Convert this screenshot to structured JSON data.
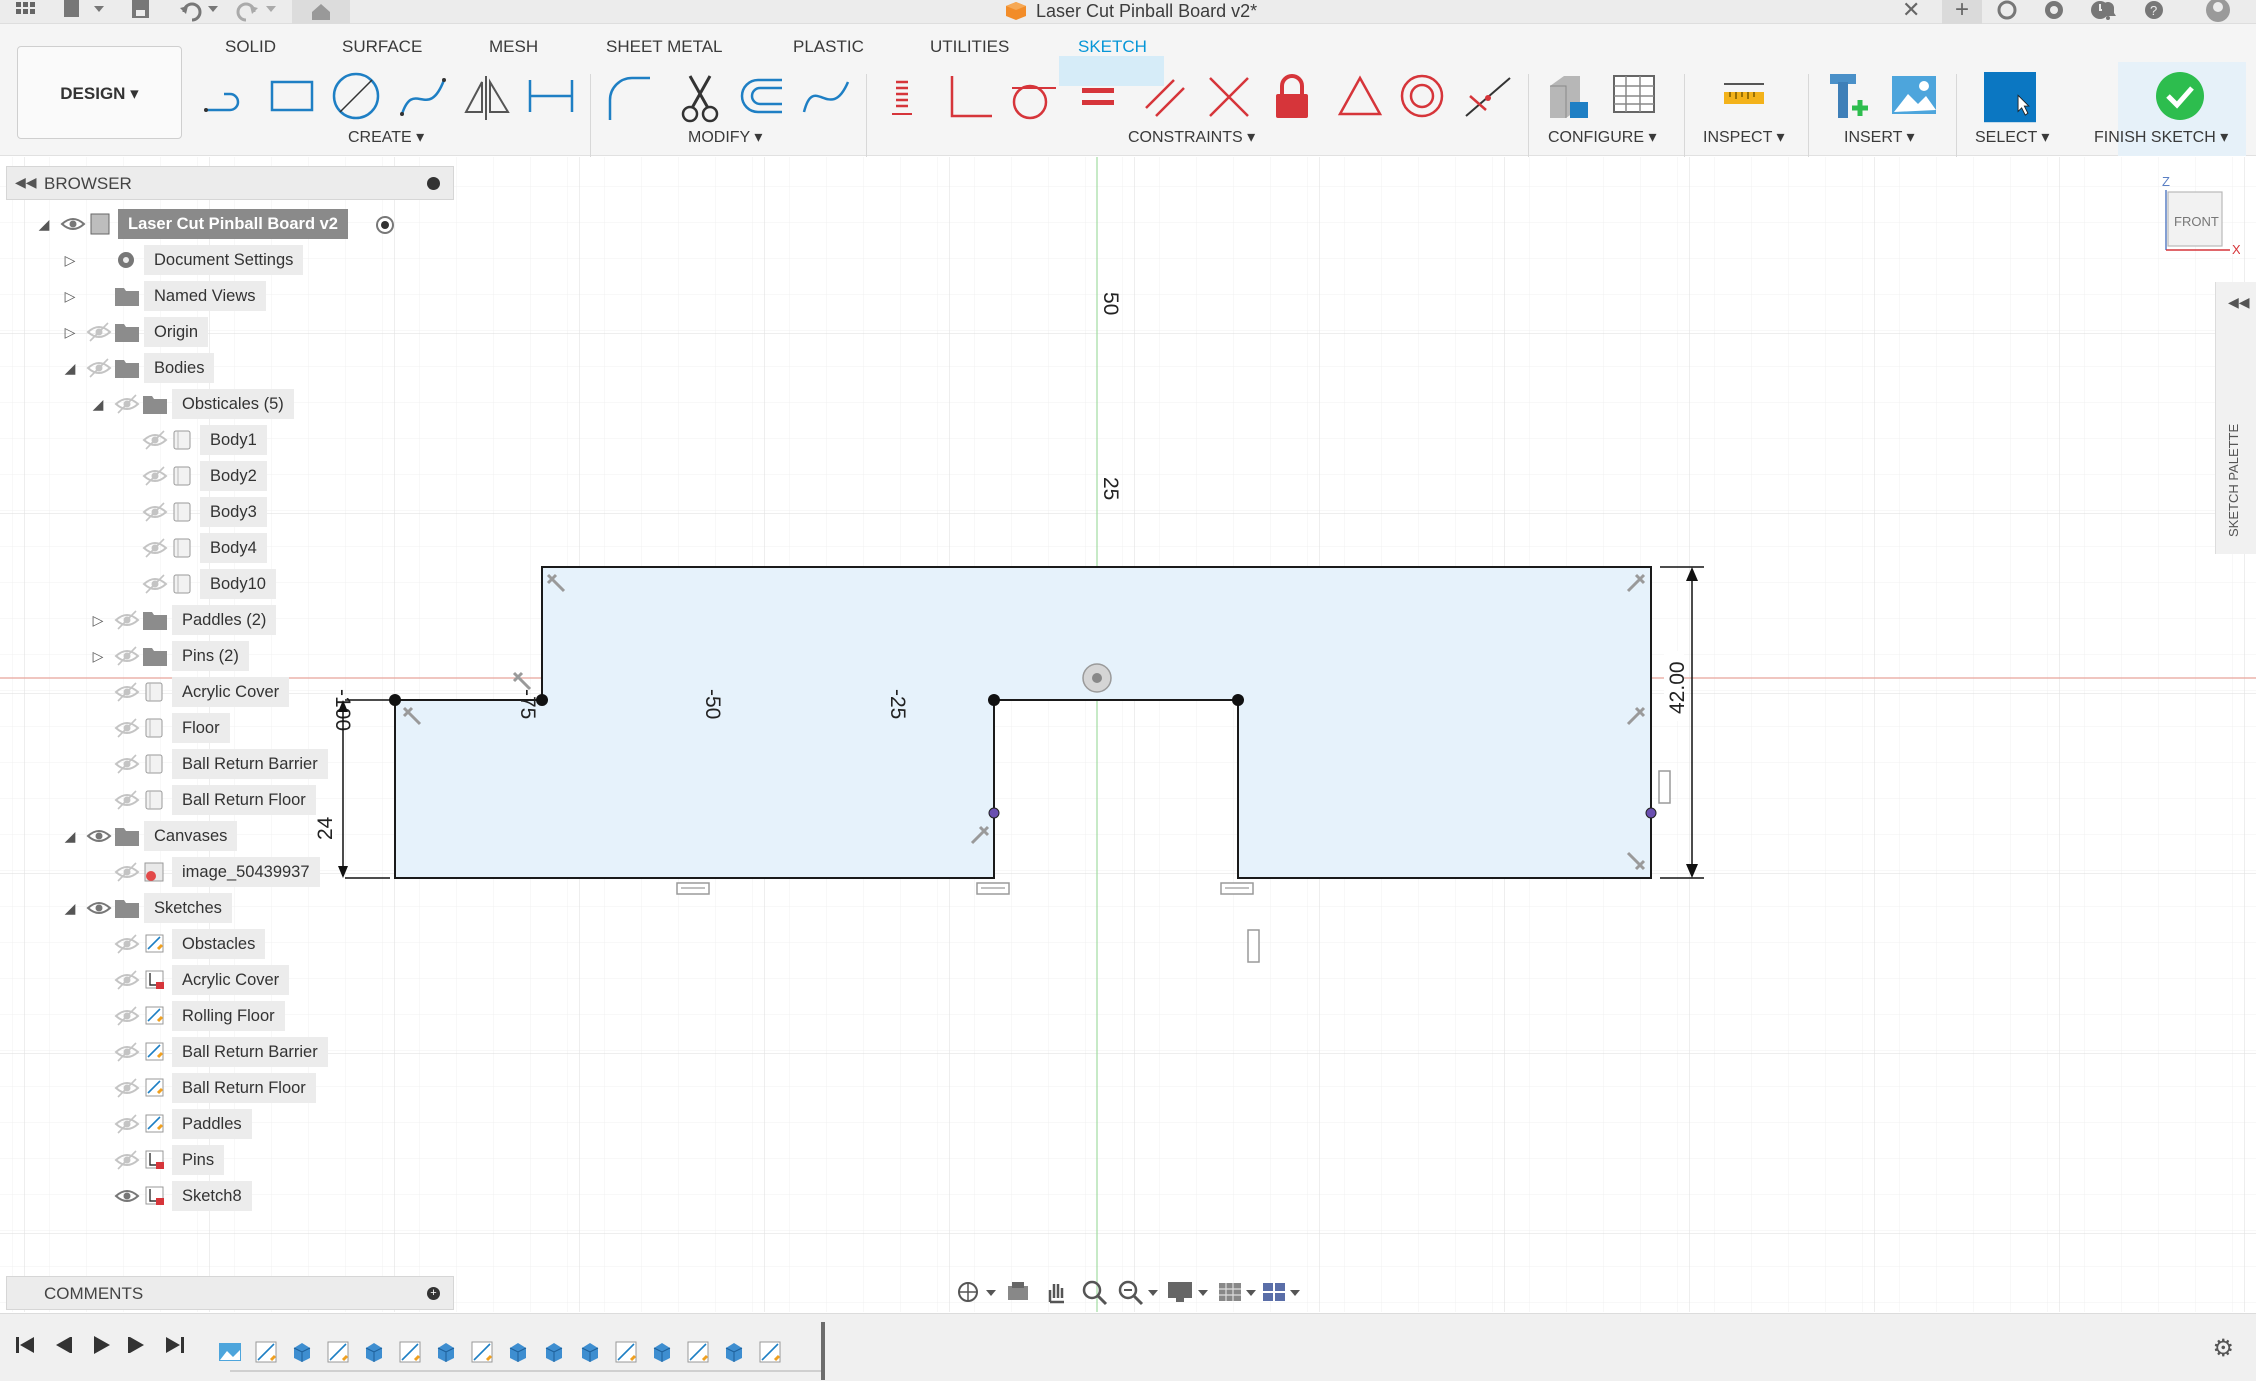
{
  "window": {
    "title": "Laser Cut Pinball Board v2*"
  },
  "ribbon": {
    "workspace": "DESIGN ▾",
    "tabs": [
      "SOLID",
      "SURFACE",
      "MESH",
      "SHEET METAL",
      "PLASTIC",
      "UTILITIES",
      "SKETCH"
    ],
    "active_tab": "SKETCH",
    "groups": {
      "create": "CREATE ▾",
      "modify": "MODIFY ▾",
      "constraints": "CONSTRAINTS ▾",
      "configure": "CONFIGURE ▾",
      "inspect": "INSPECT ▾",
      "insert": "INSERT ▾",
      "select": "SELECT ▾",
      "finish": "FINISH SKETCH ▾"
    },
    "colors": {
      "accent": "#0696d7",
      "finish_green": "#2dbd4e",
      "constraint_red": "#d6353a"
    }
  },
  "browser": {
    "title": "BROWSER",
    "items": [
      {
        "label": "Laser Cut Pinball Board v2",
        "level": 0,
        "expanded": true,
        "icon": "document-icon",
        "visible": true
      },
      {
        "label": "Document Settings",
        "level": 1,
        "expanded": false,
        "icon": "gear-icon",
        "visible": null
      },
      {
        "label": "Named Views",
        "level": 1,
        "expanded": false,
        "icon": "folder-icon",
        "visible": null
      },
      {
        "label": "Origin",
        "level": 1,
        "expanded": false,
        "icon": "folder-icon",
        "visible": false
      },
      {
        "label": "Bodies",
        "level": 1,
        "expanded": true,
        "icon": "folder-icon",
        "visible": false
      },
      {
        "label": "Obsticales (5)",
        "level": 2,
        "expanded": true,
        "icon": "folder-icon",
        "visible": false
      },
      {
        "label": "Body1",
        "level": 3,
        "icon": "body-icon",
        "visible": false
      },
      {
        "label": "Body2",
        "level": 3,
        "icon": "body-icon",
        "visible": false
      },
      {
        "label": "Body3",
        "level": 3,
        "icon": "body-icon",
        "visible": false
      },
      {
        "label": "Body4",
        "level": 3,
        "icon": "body-icon",
        "visible": false
      },
      {
        "label": "Body10",
        "level": 3,
        "icon": "body-icon",
        "visible": false
      },
      {
        "label": "Paddles (2)",
        "level": 2,
        "expanded": false,
        "icon": "folder-icon",
        "visible": false
      },
      {
        "label": "Pins (2)",
        "level": 2,
        "expanded": false,
        "icon": "folder-icon",
        "visible": false
      },
      {
        "label": "Acrylic Cover",
        "level": 2,
        "icon": "body-icon",
        "visible": false
      },
      {
        "label": "Floor",
        "level": 2,
        "icon": "body-icon",
        "visible": false
      },
      {
        "label": "Ball Return Barrier",
        "level": 2,
        "icon": "body-icon",
        "visible": false
      },
      {
        "label": "Ball Return Floor",
        "level": 2,
        "icon": "body-icon",
        "visible": false
      },
      {
        "label": "Canvases",
        "level": 1,
        "expanded": true,
        "icon": "folder-icon",
        "visible": true
      },
      {
        "label": "image_50439937",
        "level": 2,
        "icon": "canvas-image-icon",
        "visible": false
      },
      {
        "label": "Sketches",
        "level": 1,
        "expanded": true,
        "icon": "folder-icon",
        "visible": true
      },
      {
        "label": "Obstacles",
        "level": 2,
        "icon": "sketch-icon",
        "visible": false
      },
      {
        "label": "Acrylic Cover",
        "level": 2,
        "icon": "sketch-locked-icon",
        "visible": false
      },
      {
        "label": "Rolling Floor",
        "level": 2,
        "icon": "sketch-icon",
        "visible": false
      },
      {
        "label": "Ball Return Barrier",
        "level": 2,
        "icon": "sketch-icon",
        "visible": false
      },
      {
        "label": "Ball Return Floor",
        "level": 2,
        "icon": "sketch-icon",
        "visible": false
      },
      {
        "label": "Paddles",
        "level": 2,
        "icon": "sketch-icon",
        "visible": false
      },
      {
        "label": "Pins",
        "level": 2,
        "icon": "sketch-locked-icon",
        "visible": false
      },
      {
        "label": "Sketch8",
        "level": 2,
        "icon": "sketch-locked-icon",
        "visible": true
      }
    ]
  },
  "comments": {
    "title": "COMMENTS"
  },
  "sketch_palette": {
    "label": "SKETCH PALETTE"
  },
  "viewcube": {
    "face": "FRONT",
    "axis_z": "Z",
    "axis_x": "X"
  },
  "canvas": {
    "ruler_labels": {
      "v50": "50",
      "v25": "25",
      "h_neg75": "-75",
      "h_neg50": "-50",
      "h_neg25": "-25",
      "h_neg100": "-100"
    },
    "dimensions": {
      "height": "42.00",
      "step": "24"
    },
    "colors": {
      "profile_fill": "#e6f2fb",
      "x_axis": "#e4a29a",
      "z_axis": "#9ad69a",
      "grid": "#e6e6e6"
    }
  },
  "timeline": {
    "features": [
      "canvas-icon",
      "sketch-icon",
      "extrude-icon",
      "sketch-icon",
      "extrude-icon",
      "sketch-icon",
      "extrude-icon",
      "sketch-icon",
      "extrude-icon",
      "extrude-icon",
      "extrude-icon",
      "sketch-icon",
      "extrude-icon",
      "sketch-icon",
      "extrude-icon",
      "sketch-icon"
    ]
  }
}
